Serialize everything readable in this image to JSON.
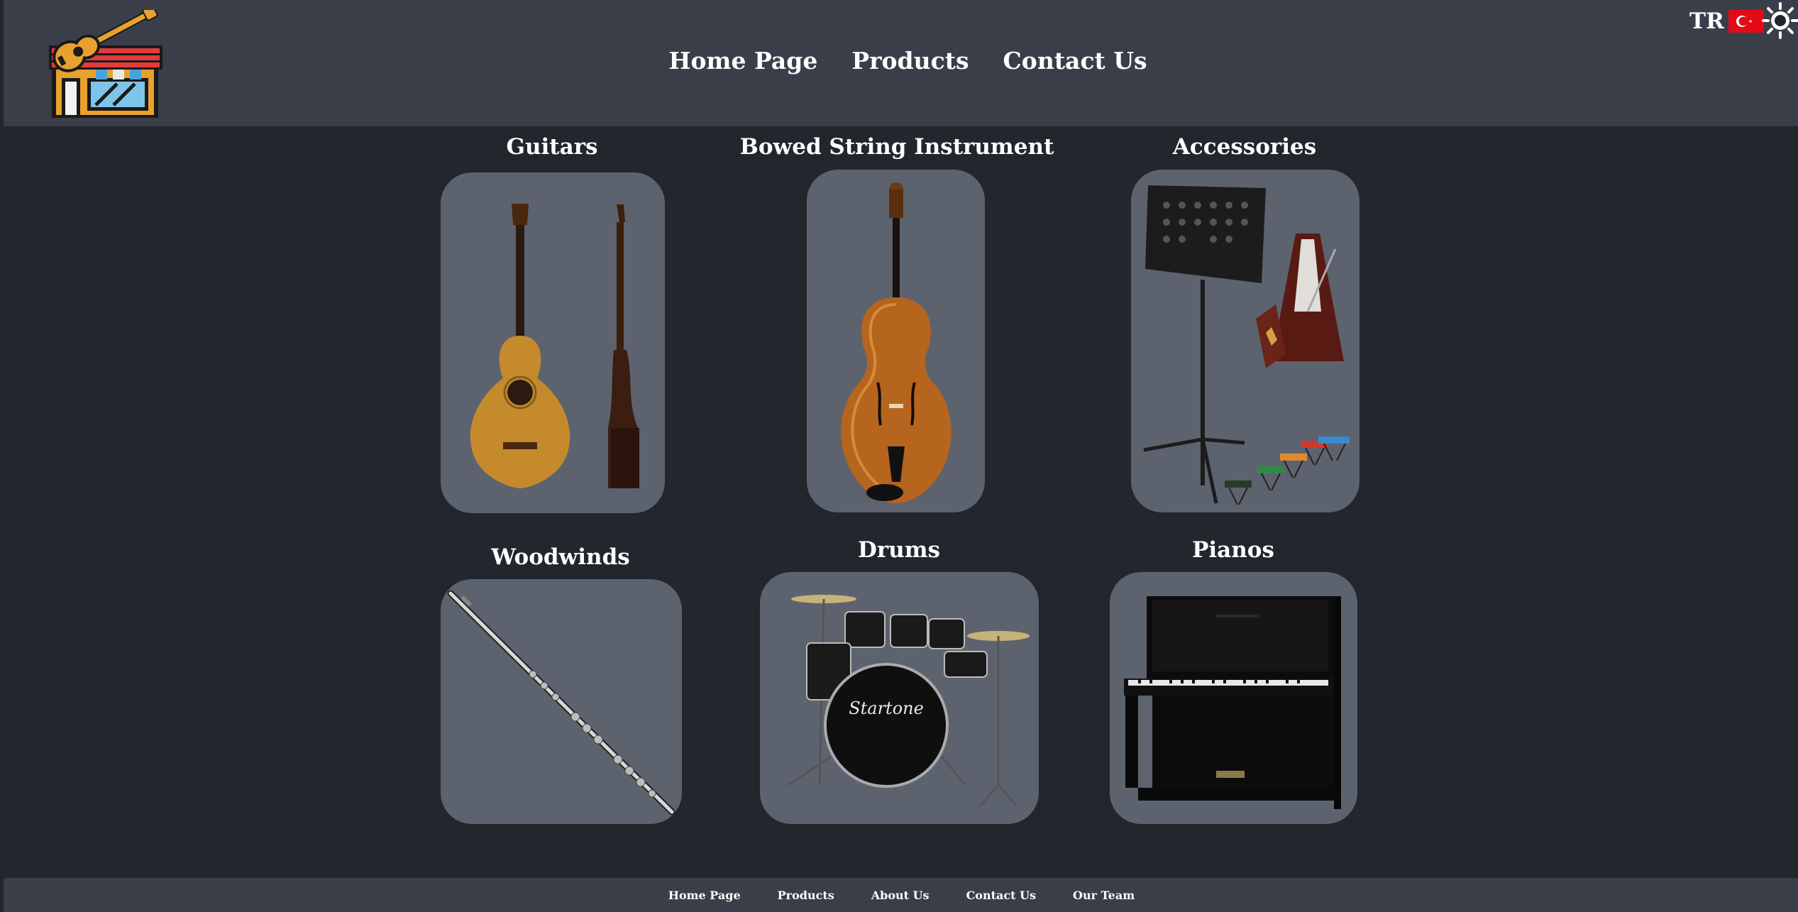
{
  "header": {
    "nav": [
      "Home Page",
      "Products",
      "Contact Us"
    ],
    "lang_code": "TR"
  },
  "icons": {
    "logo": "guitar-store-logo",
    "flag": "turkey-flag-icon",
    "theme": "sun-icon"
  },
  "categories": [
    {
      "title": "Guitars",
      "image": "classical-guitar"
    },
    {
      "title": "Bowed String Instrument",
      "image": "violin"
    },
    {
      "title": "Accessories",
      "image": "music-stand-metronome-stools"
    },
    {
      "title": "Woodwinds",
      "image": "flute"
    },
    {
      "title": "Drums",
      "image": "drum-kit"
    },
    {
      "title": "Pianos",
      "image": "upright-piano"
    }
  ],
  "drum_brand": "Startone",
  "footer": {
    "links": [
      "Home Page",
      "Products",
      "About Us",
      "Contact Us",
      "Our Team"
    ]
  },
  "colors": {
    "page_bg": "#22262d",
    "header_bg": "#393e48",
    "card_bg": "#5d636e"
  }
}
